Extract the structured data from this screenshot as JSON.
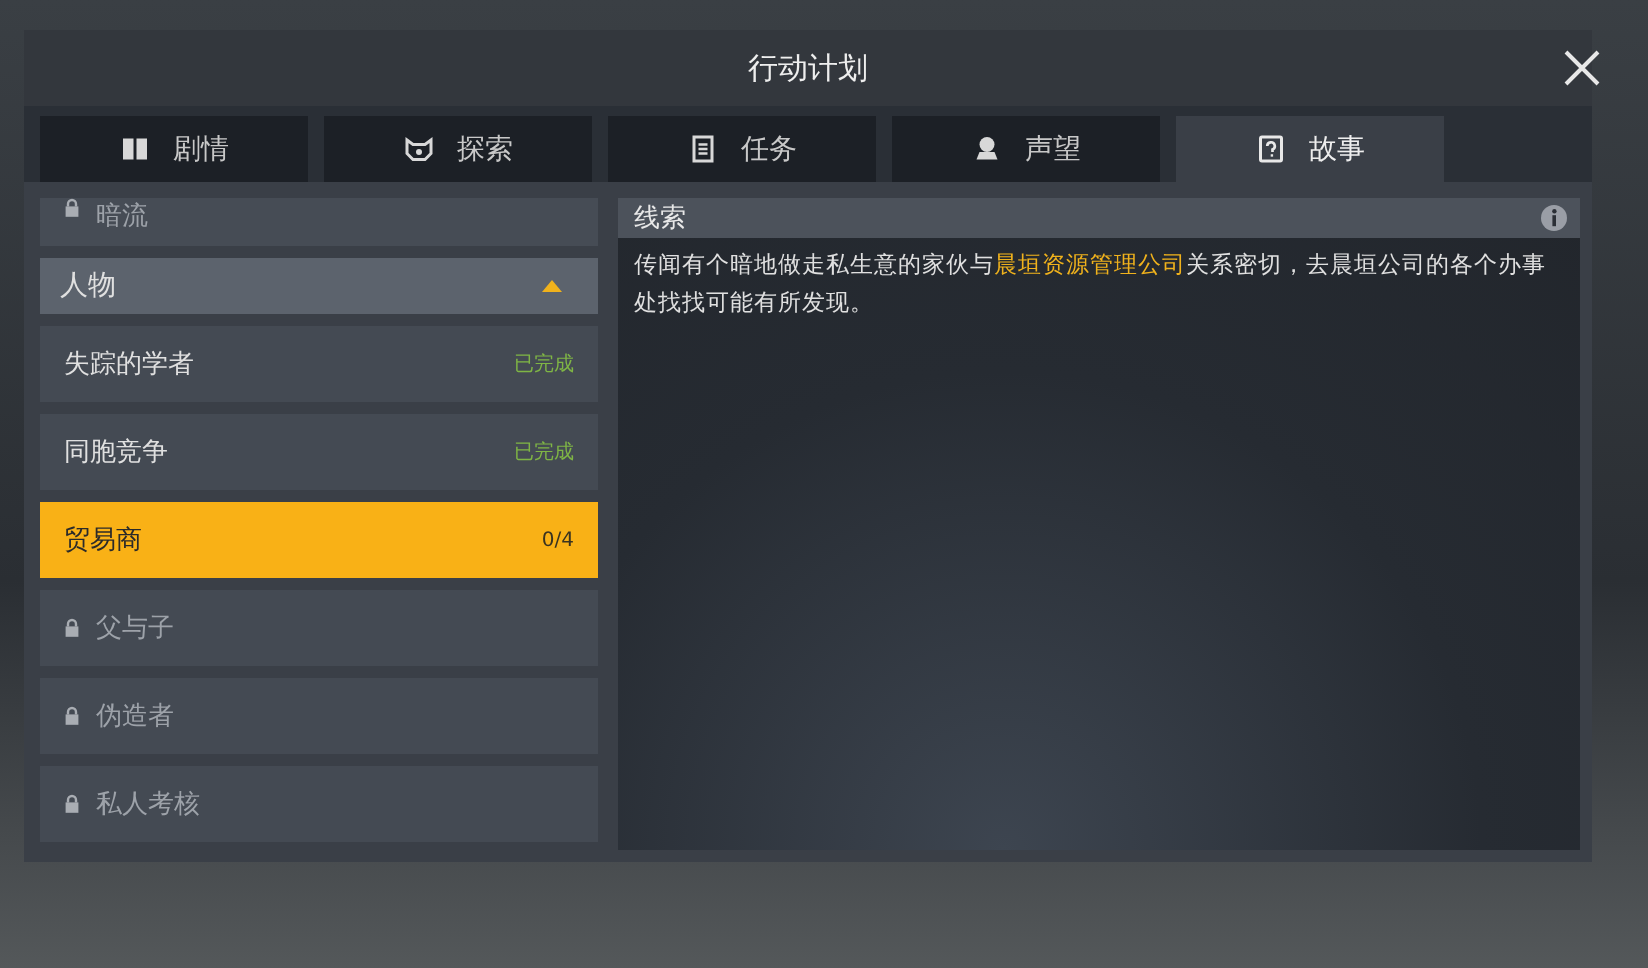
{
  "window": {
    "title": "行动计划"
  },
  "tabs": [
    {
      "label": "剧情",
      "selected": false
    },
    {
      "label": "探索",
      "selected": false
    },
    {
      "label": "任务",
      "selected": false
    },
    {
      "label": "声望",
      "selected": false
    },
    {
      "label": "故事",
      "selected": true
    }
  ],
  "sidebar": {
    "items": [
      {
        "kind": "locked",
        "label": "暗流"
      },
      {
        "kind": "header",
        "label": "人物",
        "expanded": true
      },
      {
        "kind": "quest",
        "label": "失踪的学者",
        "status": "已完成",
        "selected": false
      },
      {
        "kind": "quest",
        "label": "同胞竞争",
        "status": "已完成",
        "selected": false
      },
      {
        "kind": "quest",
        "label": "贸易商",
        "status": "0/4",
        "selected": true
      },
      {
        "kind": "locked",
        "label": "父与子"
      },
      {
        "kind": "locked",
        "label": "伪造者"
      },
      {
        "kind": "locked",
        "label": "私人考核"
      }
    ]
  },
  "clue": {
    "title": "线索",
    "text": [
      {
        "text": "传闻有个暗地做走私生意的家伙与",
        "highlight": false
      },
      {
        "text": "晨垣资源管理公司",
        "highlight": true
      },
      {
        "text": "关系密切，去晨垣公司的各个办事处找找可能有所发现。",
        "highlight": false
      }
    ]
  }
}
